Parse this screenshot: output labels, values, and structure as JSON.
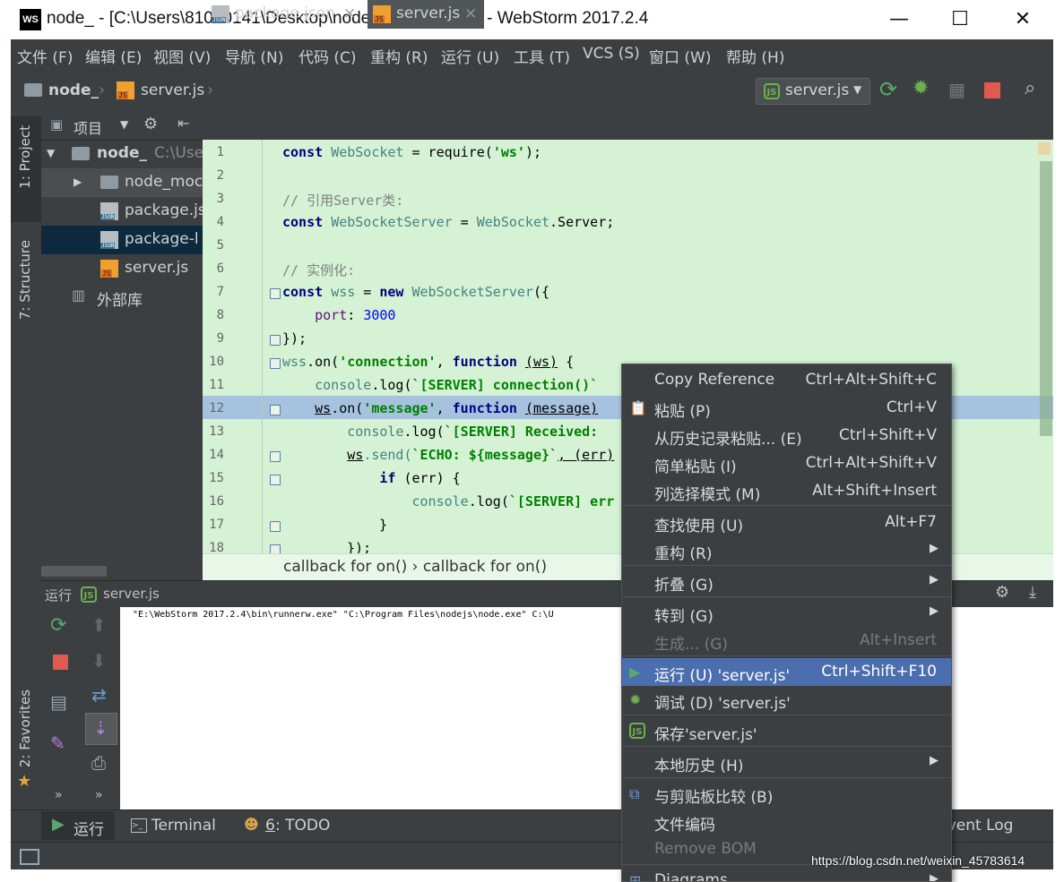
{
  "window": {
    "title": "node_ - [C:\\Users\\81000141\\Desktop\\node_] - ...\\server.js - WebStorm 2017.2.4",
    "logo": "WS",
    "minimize": "—",
    "maximize": "☐",
    "close": "✕"
  },
  "menu": [
    "文件 (F)",
    "编辑 (E)",
    "视图 (V)",
    "导航 (N)",
    "代码 (C)",
    "重构 (R)",
    "运行 (U)",
    "工具 (T)",
    "VCS (S)",
    "窗口 (W)",
    "帮助 (H)"
  ],
  "navbar": {
    "breadcrumb_project": "node_",
    "breadcrumb_file": "server.js",
    "run_config": "server.js"
  },
  "left_stripe": {
    "project": "1: Project",
    "structure": "7: Structure",
    "favorites": "2: Favorites"
  },
  "project_panel": {
    "header": "项目",
    "tree": [
      {
        "label": "node_",
        "suffix": "C:\\Use",
        "type": "root"
      },
      {
        "label": "node_moc",
        "type": "folder"
      },
      {
        "label": "package.js",
        "type": "json"
      },
      {
        "label": "package-l",
        "type": "json"
      },
      {
        "label": "server.js",
        "type": "js"
      },
      {
        "label": "外部库",
        "type": "lib"
      }
    ]
  },
  "tabs": [
    {
      "label": "package.json",
      "close": "×"
    },
    {
      "label": "server.js",
      "close": "×"
    }
  ],
  "editor": {
    "lines": [
      "1",
      "2",
      "3",
      "4",
      "5",
      "6",
      "7",
      "8",
      "9",
      "10",
      "11",
      "12",
      "13",
      "14",
      "15",
      "16",
      "17",
      "18"
    ],
    "code": {
      "l1_kw": "const",
      "l1_id": "WebSocket",
      "l1_rest": " = require(",
      "l1_str": "'ws'",
      "l1_end": ");",
      "l3": "// 引用Server类:",
      "l4_kw": "const",
      "l4_id": "WebSocketServer",
      "l4_eq": " = ",
      "l4_id2": "WebSocket",
      "l4_rest": ".Server;",
      "l6": "// 实例化:",
      "l7_kw": "const",
      "l7_id": "wss",
      "l7_eq": " = ",
      "l7_new": "new",
      "l7_cls": "WebSocketServer",
      "l7_end": "({",
      "l8_prop": "port",
      "l8_colon": ": ",
      "l8_num": "3000",
      "l9": "});",
      "l10_id": "wss",
      "l10_on": ".on(",
      "l10_str": "'connection'",
      "l10_comma": ", ",
      "l10_kw": "function",
      "l10_param": "(ws)",
      "l10_end": " {",
      "l11_id": "console",
      "l11_fn": ".log(",
      "l11_str": "`[SERVER] connection()`",
      "l12_id": "ws",
      "l12_on": ".on(",
      "l12_str": "'message'",
      "l12_comma": ", ",
      "l12_kw": "function",
      "l12_param": "(message)",
      "l13_id": "console",
      "l13_fn": ".log(",
      "l13_str": "`[SERVER] Received:",
      "l14_id": "ws",
      "l14_fn": ".send(",
      "l14_str": "`ECHO: ${message}`",
      "l14_rest": ", (err)",
      "l15_kw": "if",
      "l15_rest": " (err) {",
      "l16_id": "console",
      "l16_fn": ".log(",
      "l16_str": "`[SERVER] err",
      "l17": "}",
      "l18": "});"
    },
    "breadcrumb": "callback for on()  ›  callback for on()"
  },
  "run_panel": {
    "label": "运行",
    "config": "server.js",
    "console_text": "\"E:\\WebStorm 2017.2.4\\bin\\runnerw.exe\" \"C:\\Program Files\\nodejs\\node.exe\" C:\\U"
  },
  "bottom_tabs": {
    "run": "运行",
    "terminal": "Terminal",
    "todo_num": "6",
    "todo": ": TODO",
    "event_log": "Event Log"
  },
  "context_menu": [
    {
      "label": "Copy Reference",
      "shortcut": "Ctrl+Alt+Shift+C"
    },
    {
      "label": "粘贴 (P)",
      "shortcut": "Ctrl+V",
      "icon": "paste"
    },
    {
      "label": "从历史记录粘贴... (E)",
      "shortcut": "Ctrl+Shift+V"
    },
    {
      "label": "简单粘贴 (I)",
      "shortcut": "Ctrl+Alt+Shift+V"
    },
    {
      "label": "列选择模式 (M)",
      "shortcut": "Alt+Shift+Insert"
    },
    {
      "label": "查找使用 (U)",
      "shortcut": "Alt+F7"
    },
    {
      "label": "重构 (R)",
      "submenu": true
    },
    {
      "label": "折叠 (G)",
      "submenu": true
    },
    {
      "label": "转到 (G)",
      "submenu": true
    },
    {
      "label": "生成... (G)",
      "shortcut": "Alt+Insert",
      "disabled": true
    },
    {
      "label": "运行 (U) 'server.js'",
      "shortcut": "Ctrl+Shift+F10",
      "active": true,
      "icon": "run"
    },
    {
      "label": "调试 (D) 'server.js'",
      "icon": "debug"
    },
    {
      "label": "保存'server.js'",
      "icon": "node"
    },
    {
      "label": "本地历史 (H)",
      "submenu": true
    },
    {
      "label": "与剪贴板比较 (B)",
      "icon": "compare"
    },
    {
      "label": "文件编码"
    },
    {
      "label": "Remove BOM",
      "disabled": true
    },
    {
      "label": "Diagrams",
      "submenu": true,
      "icon": "diagram"
    }
  ],
  "watermark": "https://blog.csdn.net/weixin_45783614",
  "colors": {
    "ide_bg": "#3c3f41",
    "editor_bg": "#d5f2d5",
    "menu_active": "#4b6eaf",
    "run_green": "#59a869",
    "stop_red": "#e05a4f"
  }
}
